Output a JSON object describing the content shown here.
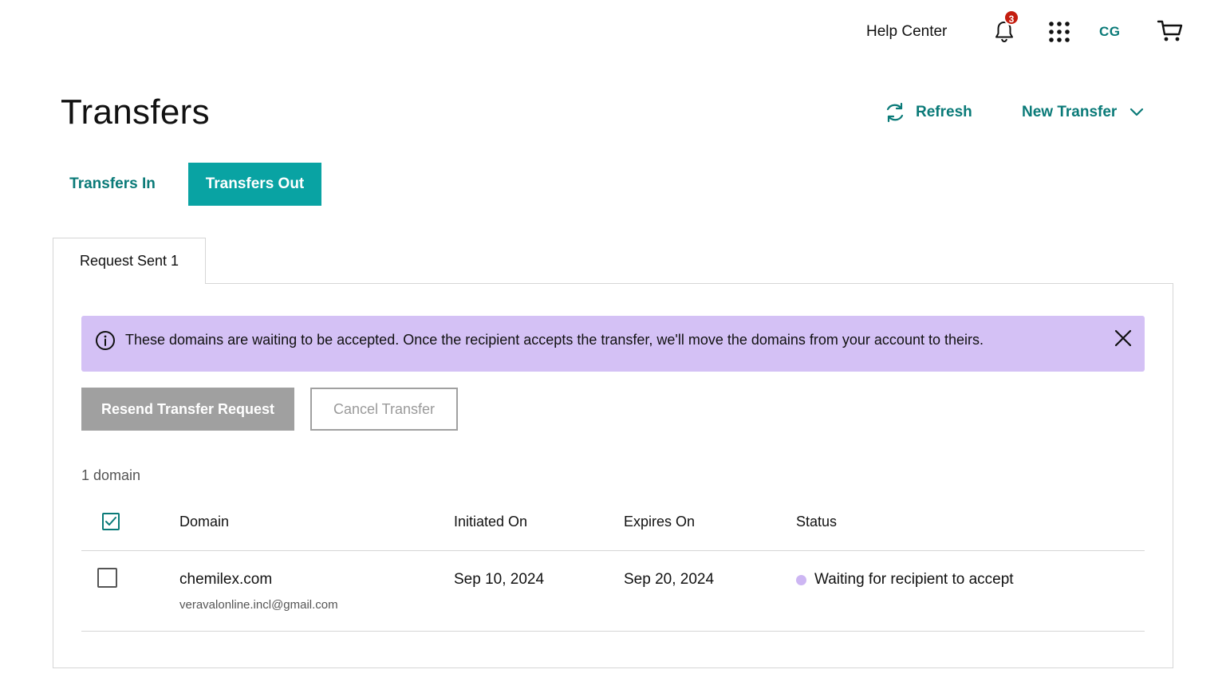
{
  "header": {
    "help_center": "Help Center",
    "notification_count": "3",
    "user_initials": "CG"
  },
  "page": {
    "title": "Transfers",
    "refresh_label": "Refresh",
    "new_transfer_label": "New Transfer"
  },
  "tabs": [
    {
      "label": "Transfers In",
      "active": false
    },
    {
      "label": "Transfers Out",
      "active": true
    }
  ],
  "subtab": {
    "label": "Request Sent 1"
  },
  "alert": {
    "text": "These domains are waiting to be accepted. Once the recipient accepts the transfer, we'll move the domains from your account to theirs."
  },
  "actions": {
    "resend_label": "Resend Transfer Request",
    "cancel_label": "Cancel Transfer"
  },
  "table": {
    "count_label": "1 domain",
    "columns": [
      "Domain",
      "Initiated On",
      "Expires On",
      "Status"
    ],
    "header_checked": true,
    "rows": [
      {
        "domain": "chemilex.com",
        "email": "veravalonline.incl@gmail.com",
        "initiated_on": "Sep 10, 2024",
        "expires_on": "Sep 20, 2024",
        "status": "Waiting for recipient to accept",
        "checked": false
      }
    ]
  },
  "colors": {
    "accent": "#0a7a78",
    "active_tab": "#09a3a3",
    "alert_bg": "#d4c1f5",
    "status_dot": "#cdb6f3",
    "badge": "#c41d0f"
  },
  "icons": [
    "bell-icon",
    "apps-grid-icon",
    "cart-icon",
    "refresh-icon",
    "chevron-down-icon",
    "info-icon",
    "close-icon",
    "checkmark-icon"
  ]
}
